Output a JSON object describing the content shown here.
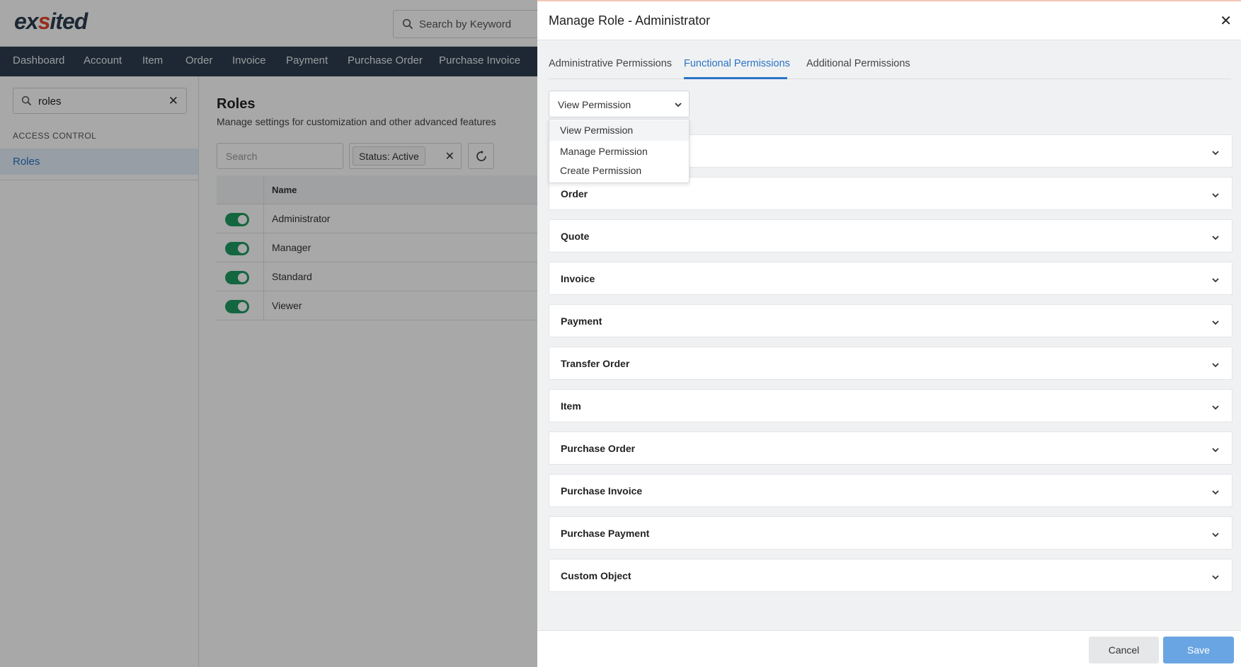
{
  "app": {
    "logo_left": "ex",
    "logo_accent": "s",
    "logo_right": "ited",
    "keyword_search_placeholder": "Search by Keyword"
  },
  "nav": {
    "items": [
      "Dashboard",
      "Account",
      "Item",
      "Order",
      "Invoice",
      "Payment",
      "Purchase Order",
      "Purchase Invoice"
    ]
  },
  "sidebar": {
    "search_value": "roles",
    "section_title": "ACCESS CONTROL",
    "items": [
      {
        "label": "Roles"
      }
    ]
  },
  "main": {
    "title": "Roles",
    "subtitle": "Manage settings for customization and other advanced features",
    "search_placeholder": "Search",
    "status_chip": "Status: Active",
    "table": {
      "columns": [
        "Name"
      ],
      "rows": [
        {
          "name": "Administrator",
          "active": true
        },
        {
          "name": "Manager",
          "active": true
        },
        {
          "name": "Standard",
          "active": true
        },
        {
          "name": "Viewer",
          "active": true
        }
      ]
    }
  },
  "modal": {
    "title": "Manage Role - Administrator",
    "tabs": [
      "Administrative Permissions",
      "Functional Permissions",
      "Additional Permissions"
    ],
    "active_tab": "Functional Permissions",
    "permission_select": {
      "value": "View Permission",
      "options": [
        "View Permission",
        "Manage Permission",
        "Create Permission"
      ]
    },
    "sections": [
      "",
      "Order",
      "Quote",
      "Invoice",
      "Payment",
      "Transfer Order",
      "Item",
      "Purchase Order",
      "Purchase Invoice",
      "Purchase Payment",
      "Custom Object"
    ],
    "buttons": {
      "cancel": "Cancel",
      "save": "Save"
    }
  },
  "colors": {
    "nav_bg": "#2c3e50",
    "accent": "#2a73c5",
    "toggle_on": "#1f9b63",
    "save_button": "#6aa5e3"
  }
}
